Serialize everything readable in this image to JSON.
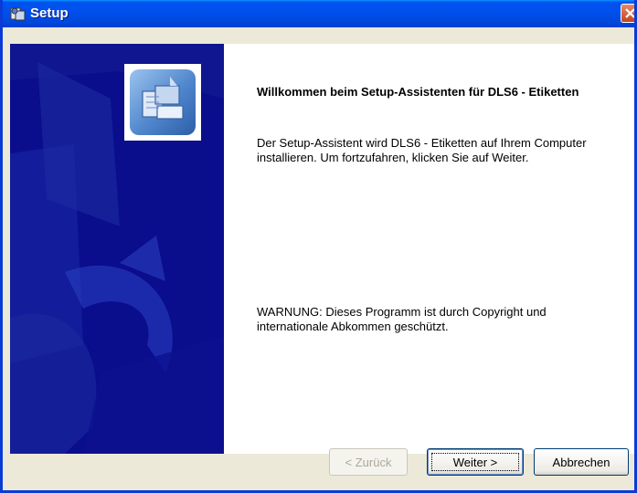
{
  "window": {
    "title": "Setup",
    "close_icon": "close-icon"
  },
  "panel": {
    "icon": "setup-wizard-icon"
  },
  "content": {
    "welcome": "Willkommen beim Setup-Assistenten für DLS6 - Etiketten",
    "intro": "Der Setup-Assistent wird DLS6 - Etiketten auf Ihrem Computer installieren. Um fortzufahren, klicken Sie auf Weiter.",
    "warning": "WARNUNG: Dieses Programm ist durch Copyright und internationale Abkommen geschützt."
  },
  "buttons": {
    "back": "< Zurück",
    "next": "Weiter >",
    "cancel": "Abbrechen",
    "back_enabled": false
  },
  "colors": {
    "titlebar": "#0053ee",
    "side_panel": "#0a0d8c",
    "dialog_bg": "#ece9d8"
  }
}
